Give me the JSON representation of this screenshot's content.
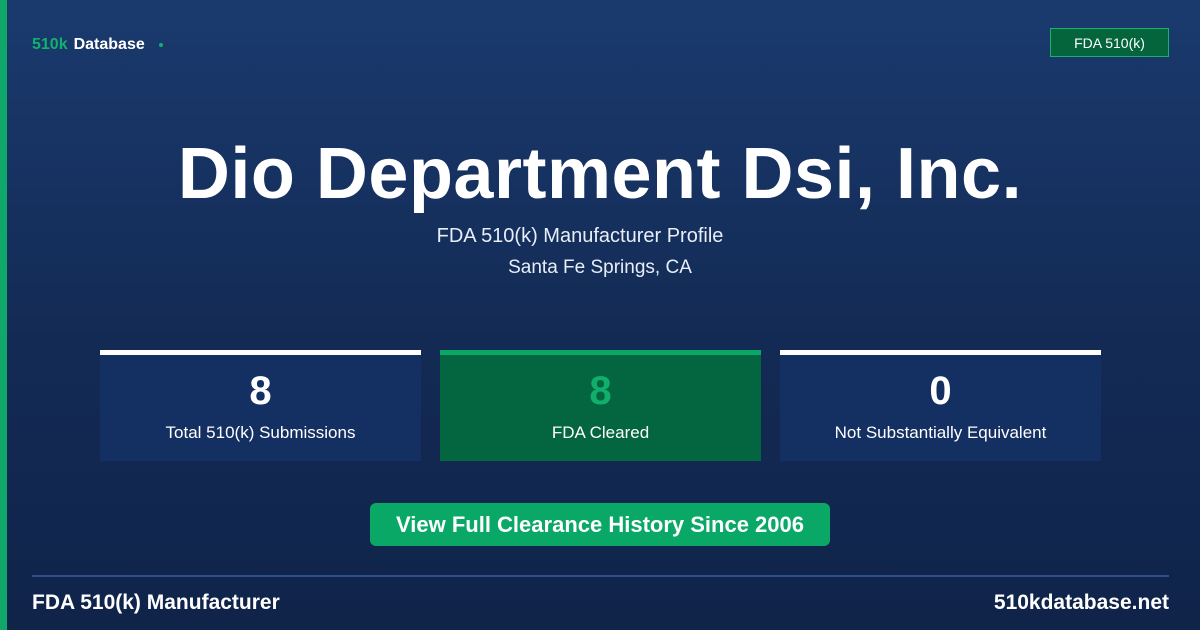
{
  "colors": {
    "background": "#132a54",
    "accent_green": "#0aa867",
    "badge_green": "#04653d",
    "card_blue": "#142f62",
    "white": "#ffffff"
  },
  "header": {
    "brand_accent": "510k",
    "brand_word": "Database",
    "badge_label": "FDA 510(k)"
  },
  "hero": {
    "company_name": "Dio Department Dsi, Inc.",
    "subtitle": "FDA 510(k) Manufacturer Profile",
    "location": "Santa Fe Springs, CA"
  },
  "stats": [
    {
      "value": "8",
      "label": "Total 510(k) Submissions"
    },
    {
      "value": "8",
      "label": "FDA Cleared"
    },
    {
      "value": "0",
      "label": "Not Substantially Equivalent"
    }
  ],
  "cta": {
    "label": "View Full Clearance History Since 2006"
  },
  "footer": {
    "left": "FDA 510(k) Manufacturer",
    "right": "510kdatabase.net"
  }
}
